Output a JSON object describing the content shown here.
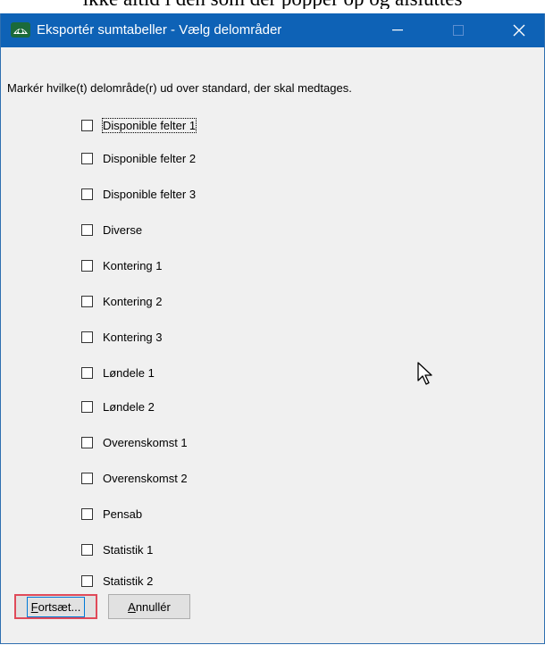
{
  "background_text": "ikke altid i den som der popper op og alsluttes",
  "window": {
    "title": "Eksportér sumtabeller - Vælg delområder",
    "minimize_glyph": "—",
    "maximize_glyph": "☐",
    "close_glyph": "✕"
  },
  "instruction": "Markér hvilke(t) delområde(r) ud over standard, der skal medtages.",
  "options": [
    {
      "label": "Disponible felter 1",
      "checked": false
    },
    {
      "label": "Disponible felter 2",
      "checked": false
    },
    {
      "label": "Disponible felter 3",
      "checked": false
    },
    {
      "label": "Diverse",
      "checked": false
    },
    {
      "label": "Kontering 1",
      "checked": false
    },
    {
      "label": "Kontering 2",
      "checked": false
    },
    {
      "label": "Kontering 3",
      "checked": false
    },
    {
      "label": "Løndele 1",
      "checked": false
    },
    {
      "label": "Løndele 2",
      "checked": false
    },
    {
      "label": "Overenskomst 1",
      "checked": false
    },
    {
      "label": "Overenskomst 2",
      "checked": false
    },
    {
      "label": "Pensab",
      "checked": false
    },
    {
      "label": "Statistik 1",
      "checked": false
    },
    {
      "label": "Statistik 2",
      "checked": false
    }
  ],
  "buttons": {
    "continue_first": "F",
    "continue_rest": "ortsæt...",
    "cancel_first": "A",
    "cancel_rest": "nnullér"
  },
  "colors": {
    "titlebar": "#0e62b6",
    "highlight": "#e04a59"
  }
}
